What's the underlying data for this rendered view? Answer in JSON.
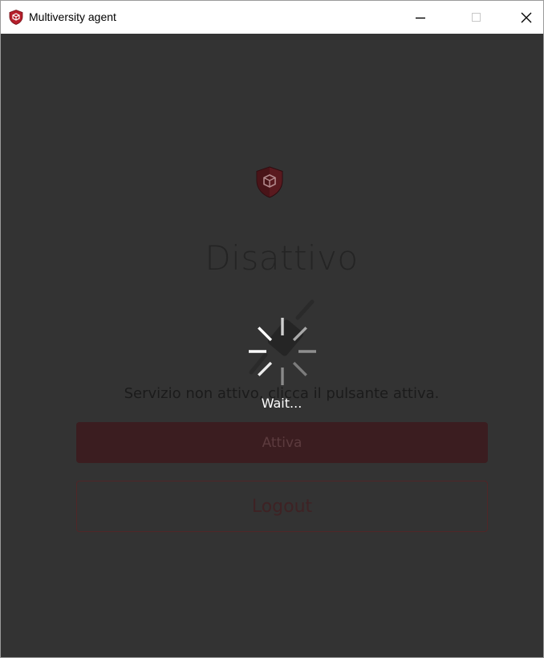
{
  "window": {
    "title": "Multiversity agent",
    "icon": "shield-cube-icon",
    "controls": {
      "minimize": "minimize-icon",
      "maximize": "maximize-icon",
      "close": "close-icon"
    }
  },
  "main": {
    "logo": "shield-cube-icon",
    "status_title": "Disattivo",
    "status_message": "Servizio non attivo, clicca il pulsante attiva.",
    "activate_label": "Attiva",
    "logout_label": "Logout"
  },
  "overlay": {
    "spinner": "loading-spinner-icon",
    "plug_icon": "plug-icon",
    "wait_text": "Wait..."
  },
  "colors": {
    "background": "#333333",
    "accent": "#8b1a22",
    "titlebar": "#ffffff"
  }
}
